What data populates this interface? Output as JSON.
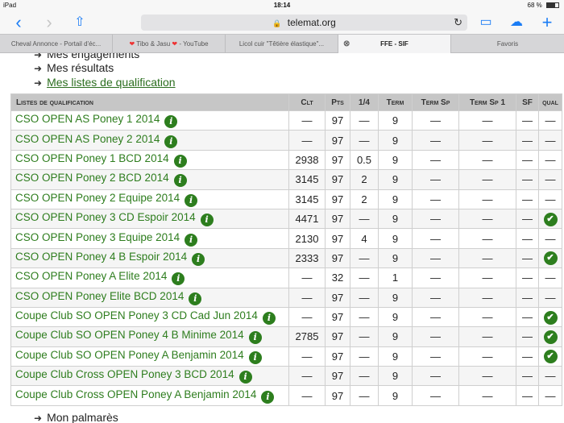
{
  "status": {
    "device": "iPad",
    "time": "18:14",
    "battery": "68 %",
    "battery_level": 0.68
  },
  "toolbar": {
    "url": "telemat.org"
  },
  "tabs": [
    {
      "label": "Cheval Annonce - Portail d'éc..."
    },
    {
      "label": "Tibo & Jasu",
      "suffix": "- YouTube"
    },
    {
      "label": "Licol cuir \"Têtière élastique\"..."
    },
    {
      "label": "FFE - SIF",
      "active": true
    },
    {
      "label": "Favoris"
    }
  ],
  "links": {
    "engagements": "Mes engagements",
    "resultats": "Mes résultats",
    "listes": "Mes listes de qualification",
    "palmares": "Mon palmarès"
  },
  "table": {
    "headers": [
      "Listes de qualification",
      "Clt",
      "Pts",
      "1/4",
      "Term",
      "Term Sp",
      "Term Sp 1",
      "SF",
      "qual"
    ],
    "rows": [
      {
        "name": "CSO OPEN AS Poney 1 2014",
        "clt": "—",
        "pts": "97",
        "q": "—",
        "term": "9",
        "tsp": "—",
        "tsp1": "—",
        "sf": "—",
        "qual": "—"
      },
      {
        "name": "CSO OPEN AS Poney 2 2014",
        "clt": "—",
        "pts": "97",
        "q": "—",
        "term": "9",
        "tsp": "—",
        "tsp1": "—",
        "sf": "—",
        "qual": "—"
      },
      {
        "name": "CSO OPEN Poney 1 BCD 2014",
        "clt": "2938",
        "pts": "97",
        "q": "0.5",
        "term": "9",
        "tsp": "—",
        "tsp1": "—",
        "sf": "—",
        "qual": "—"
      },
      {
        "name": "CSO OPEN Poney 2 BCD 2014",
        "clt": "3145",
        "pts": "97",
        "q": "2",
        "term": "9",
        "tsp": "—",
        "tsp1": "—",
        "sf": "—",
        "qual": "—"
      },
      {
        "name": "CSO OPEN Poney 2 Equipe 2014",
        "clt": "3145",
        "pts": "97",
        "q": "2",
        "term": "9",
        "tsp": "—",
        "tsp1": "—",
        "sf": "—",
        "qual": "—"
      },
      {
        "name": "CSO OPEN Poney 3 CD Espoir 2014",
        "clt": "4471",
        "pts": "97",
        "q": "—",
        "term": "9",
        "tsp": "—",
        "tsp1": "—",
        "sf": "—",
        "qual": "check"
      },
      {
        "name": "CSO OPEN Poney 3 Equipe 2014",
        "clt": "2130",
        "pts": "97",
        "q": "4",
        "term": "9",
        "tsp": "—",
        "tsp1": "—",
        "sf": "—",
        "qual": "—"
      },
      {
        "name": "CSO OPEN Poney 4 B Espoir 2014",
        "clt": "2333",
        "pts": "97",
        "q": "—",
        "term": "9",
        "tsp": "—",
        "tsp1": "—",
        "sf": "—",
        "qual": "check"
      },
      {
        "name": "CSO OPEN Poney A Elite 2014",
        "clt": "—",
        "pts": "32",
        "q": "—",
        "term": "1",
        "tsp": "—",
        "tsp1": "—",
        "sf": "—",
        "qual": "—"
      },
      {
        "name": "CSO OPEN Poney Elite BCD 2014",
        "clt": "—",
        "pts": "97",
        "q": "—",
        "term": "9",
        "tsp": "—",
        "tsp1": "—",
        "sf": "—",
        "qual": "—"
      },
      {
        "name": "Coupe Club SO OPEN Poney 3 CD Cad Jun 2014",
        "clt": "—",
        "pts": "97",
        "q": "—",
        "term": "9",
        "tsp": "—",
        "tsp1": "—",
        "sf": "—",
        "qual": "check"
      },
      {
        "name": "Coupe Club SO OPEN Poney 4 B Minime 2014",
        "clt": "2785",
        "pts": "97",
        "q": "—",
        "term": "9",
        "tsp": "—",
        "tsp1": "—",
        "sf": "—",
        "qual": "check"
      },
      {
        "name": "Coupe Club SO OPEN Poney A Benjamin 2014",
        "clt": "—",
        "pts": "97",
        "q": "—",
        "term": "9",
        "tsp": "—",
        "tsp1": "—",
        "sf": "—",
        "qual": "check"
      },
      {
        "name": "Coupe Club Cross OPEN Poney 3 BCD 2014",
        "clt": "—",
        "pts": "97",
        "q": "—",
        "term": "9",
        "tsp": "—",
        "tsp1": "—",
        "sf": "—",
        "qual": "—"
      },
      {
        "name": "Coupe Club Cross OPEN Poney A Benjamin 2014",
        "clt": "—",
        "pts": "97",
        "q": "—",
        "term": "9",
        "tsp": "—",
        "tsp1": "—",
        "sf": "—",
        "qual": "—"
      }
    ]
  }
}
